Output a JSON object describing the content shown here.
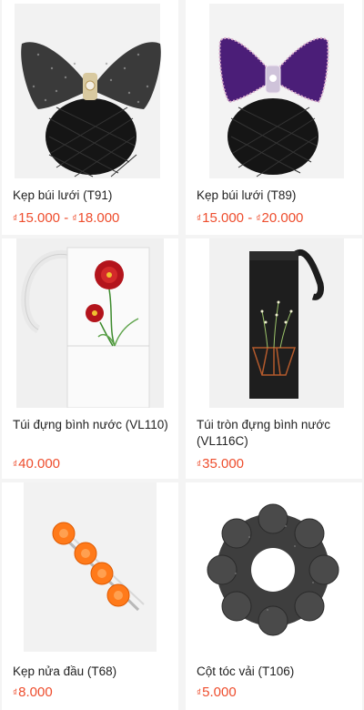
{
  "products": [
    {
      "name": "Kẹp búi lưới (T91)",
      "currency": "₫",
      "price_min": "15.000",
      "price_sep": " - ",
      "price_max": "18.000",
      "image_icon": "black-glitter-bow-hair-net-image"
    },
    {
      "name": "Kẹp búi lưới (T89)",
      "currency": "₫",
      "price_min": "15.000",
      "price_sep": " - ",
      "price_max": "20.000",
      "image_icon": "purple-bow-hair-net-image"
    },
    {
      "name": "Túi đựng bình nước (VL110)",
      "currency": "₫",
      "price": "40.000",
      "image_icon": "white-bottle-bag-red-flower-image"
    },
    {
      "name": "Túi tròn đựng bình nước (VL116C)",
      "currency": "₫",
      "price": "35.000",
      "image_icon": "black-bottle-bag-embroidery-image"
    },
    {
      "name": "Kẹp nửa đầu (T68)",
      "currency": "₫",
      "price": "8.000",
      "image_icon": "orange-rose-hair-clip-image"
    },
    {
      "name": "Cột tóc vải (T106)",
      "currency": "₫",
      "price": "5.000",
      "image_icon": "grey-fabric-scrunchie-image"
    }
  ],
  "colors": {
    "price": "#ee4d2d",
    "text": "#222222",
    "background": "#f4f4f4"
  }
}
